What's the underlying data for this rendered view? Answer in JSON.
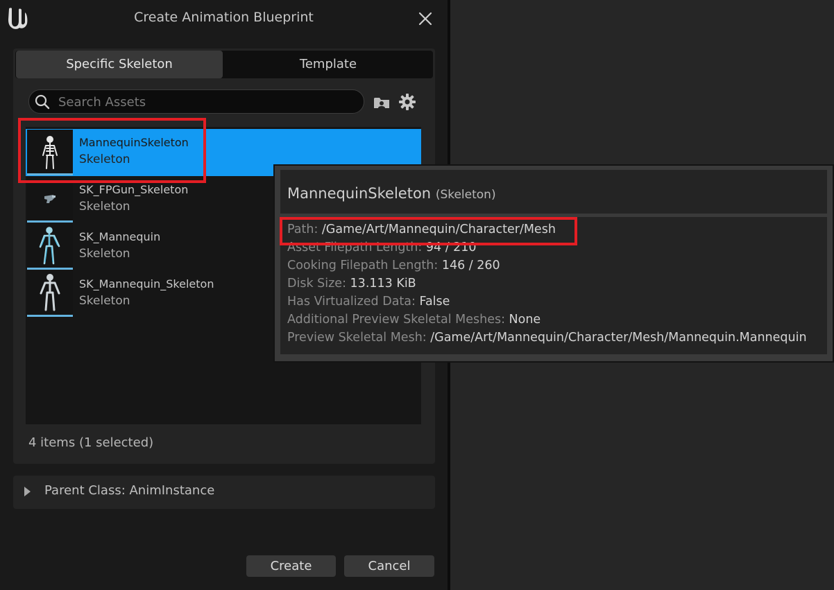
{
  "dialog": {
    "title": "Create Animation Blueprint",
    "tabs": [
      {
        "label": "Specific Skeleton",
        "active": true
      },
      {
        "label": "Template",
        "active": false
      }
    ],
    "search": {
      "placeholder": "Search Assets",
      "value": ""
    },
    "assets": [
      {
        "name": "MannequinSkeleton",
        "type": "Skeleton",
        "selected": true
      },
      {
        "name": "SK_FPGun_Skeleton",
        "type": "Skeleton",
        "selected": false
      },
      {
        "name": "SK_Mannequin",
        "type": "Skeleton",
        "selected": false
      },
      {
        "name": "SK_Mannequin_Skeleton",
        "type": "Skeleton",
        "selected": false
      }
    ],
    "item_count_text": "4 items (1 selected)",
    "parent_class_text": "Parent Class: AnimInstance",
    "buttons": {
      "create": "Create",
      "cancel": "Cancel"
    }
  },
  "tooltip": {
    "title": "MannequinSkeleton",
    "title_type": "(Skeleton)",
    "rows": [
      {
        "key": "Path: ",
        "value": "/Game/Art/Mannequin/Character/Mesh"
      },
      {
        "key": "Asset Filepath Length: ",
        "value": "94 / 210"
      },
      {
        "key": "Cooking Filepath Length: ",
        "value": "146 / 260"
      },
      {
        "key": "Disk Size: ",
        "value": "13.113 KiB"
      },
      {
        "key": "Has Virtualized Data: ",
        "value": "False"
      },
      {
        "key": "Additional Preview Skeletal Meshes: ",
        "value": "None"
      },
      {
        "key": "Preview Skeletal Mesh: ",
        "value": "/Game/Art/Mannequin/Character/Mesh/Mannequin.Mannequin"
      }
    ]
  },
  "colors": {
    "selection": "#139af3",
    "highlight": "#e31e24",
    "background": "#1a1a1a"
  }
}
